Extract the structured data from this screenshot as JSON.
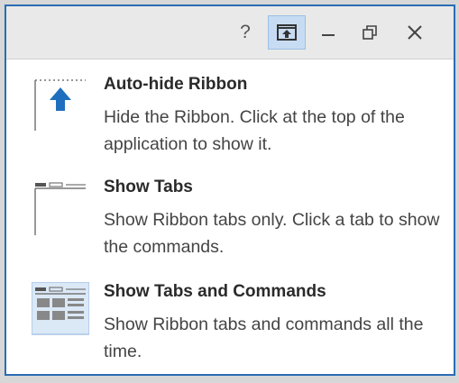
{
  "titlebar": {
    "help_label": "?",
    "help_icon": "question-mark-icon",
    "ribbon_options_icon": "ribbon-display-options-icon",
    "minimize_icon": "minimize-icon",
    "restore_icon": "restore-icon",
    "close_icon": "close-icon",
    "accent_color": "#c7dcf2"
  },
  "menu": {
    "items": [
      {
        "title": "Auto-hide Ribbon",
        "description": "Hide the Ribbon. Click at the top of the application to show it.",
        "icon": "auto-hide-ribbon-icon",
        "selected": false
      },
      {
        "title": "Show Tabs",
        "description": "Show Ribbon tabs only. Click a tab to show the commands.",
        "icon": "show-tabs-icon",
        "selected": false
      },
      {
        "title": "Show Tabs and Commands",
        "description": "Show Ribbon tabs and commands all the time.",
        "icon": "show-tabs-and-commands-icon",
        "selected": true
      }
    ]
  },
  "colors": {
    "window_border": "#2b6cb4",
    "selected_highlight": "#dbe8f6",
    "arrow_blue": "#1f6fbf"
  }
}
